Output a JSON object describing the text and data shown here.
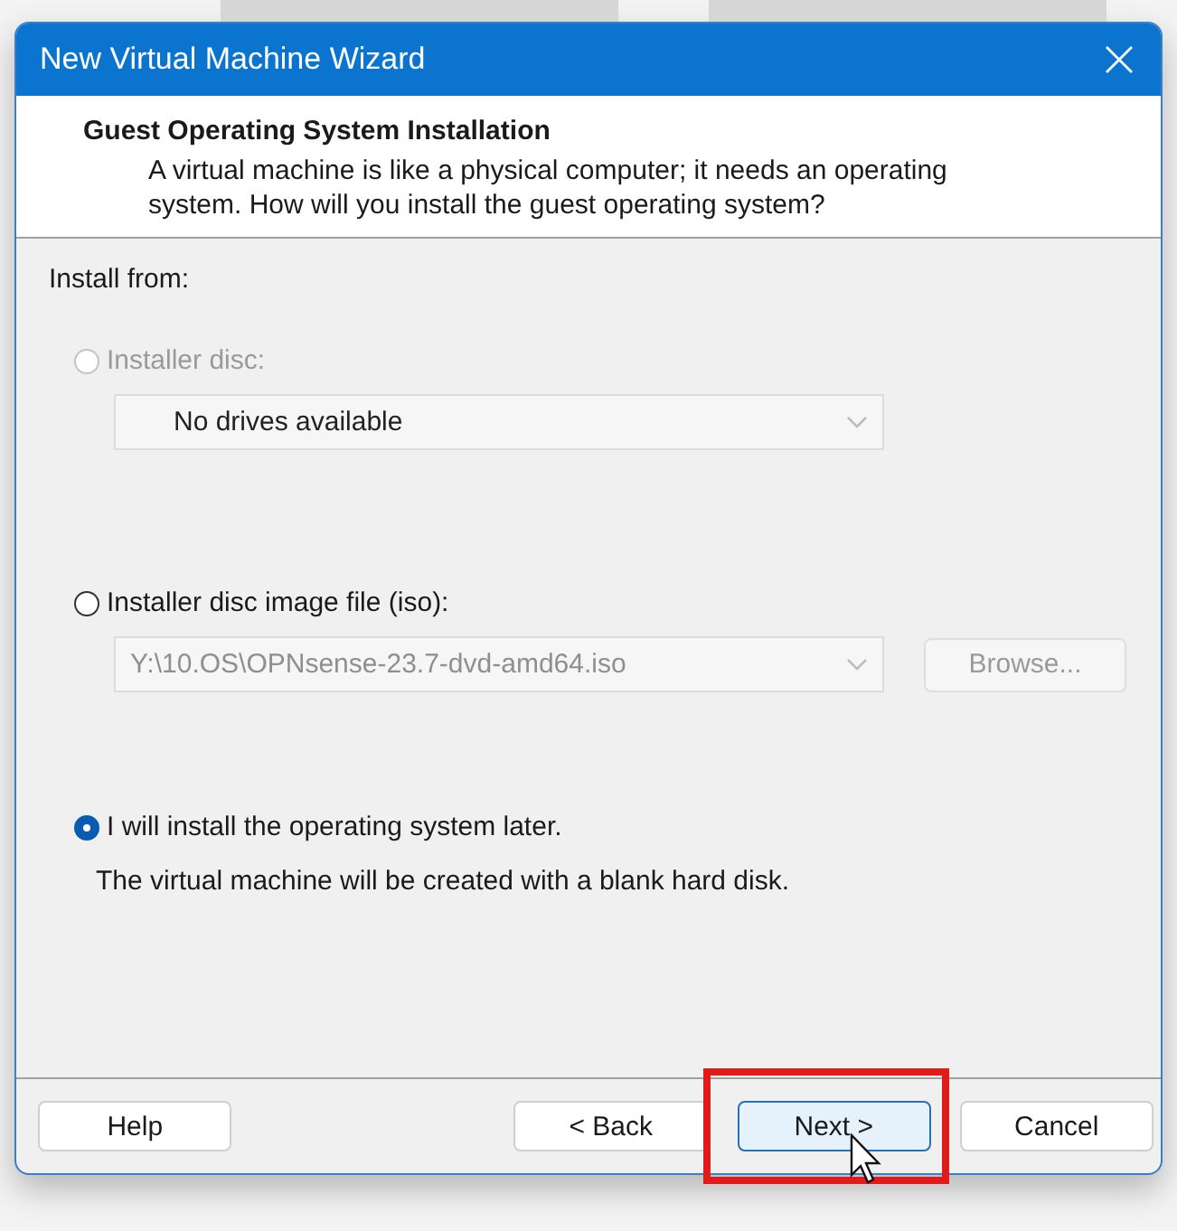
{
  "window": {
    "title": "New Virtual Machine Wizard"
  },
  "header": {
    "title": "Guest Operating System Installation",
    "description": "A virtual machine is like a physical computer; it needs an operating system. How will you install the guest operating system?"
  },
  "install_from": {
    "label": "Install from:",
    "options": [
      {
        "kind": "disc",
        "label": "Installer disc:",
        "selected": false,
        "disabled": true,
        "dropdown": {
          "value": "No drives available",
          "disabled": true
        }
      },
      {
        "kind": "iso",
        "label": "Installer disc image file (iso):",
        "selected": false,
        "disabled": false,
        "dropdown": {
          "value": "Y:\\10.OS\\OPNsense-23.7-dvd-amd64.iso",
          "disabled": true
        },
        "browse": {
          "label": "Browse...",
          "disabled": true
        }
      },
      {
        "kind": "later",
        "label": "I will install the operating system later.",
        "selected": true,
        "disabled": false,
        "note": "The virtual machine will be created with a blank hard disk."
      }
    ]
  },
  "buttons": [
    {
      "label": "Help",
      "highlighted": false
    },
    {
      "label": "< Back",
      "highlighted": false
    },
    {
      "label": "Next >",
      "highlighted": true
    },
    {
      "label": "Cancel",
      "highlighted": false
    }
  ]
}
